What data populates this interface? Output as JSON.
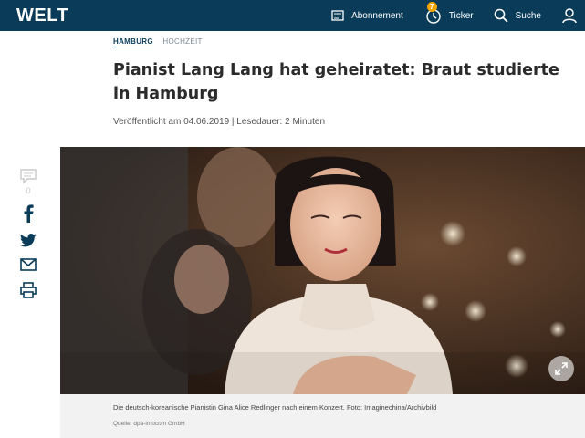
{
  "header": {
    "logo": "WELT",
    "nav": [
      {
        "label": "Abonnement",
        "icon": "newspaper-icon"
      },
      {
        "label": "Ticker",
        "icon": "ticker-icon",
        "badge": "7"
      },
      {
        "label": "Suche",
        "icon": "search-icon"
      },
      {
        "label": "",
        "icon": "user-icon"
      }
    ]
  },
  "breadcrumb": [
    "HAMBURG",
    "HOCHZEIT"
  ],
  "article": {
    "title": "Pianist Lang Lang hat geheiratet: Braut studierte in Hamburg",
    "meta": "Veröffentlicht am 04.06.2019 | Lesedauer: 2 Minuten",
    "comment_count": "0",
    "caption": "Die deutsch-koreanische Pianistin Gina Alice Redlinger nach einem Konzert. Foto: Imaginechina/Archivbild",
    "source": "Quelle: dpa-infocom GmbH"
  },
  "colors": {
    "brand": "#0a3c5a",
    "badge": "#f5a400",
    "share_icons": "#0a3c5a"
  }
}
